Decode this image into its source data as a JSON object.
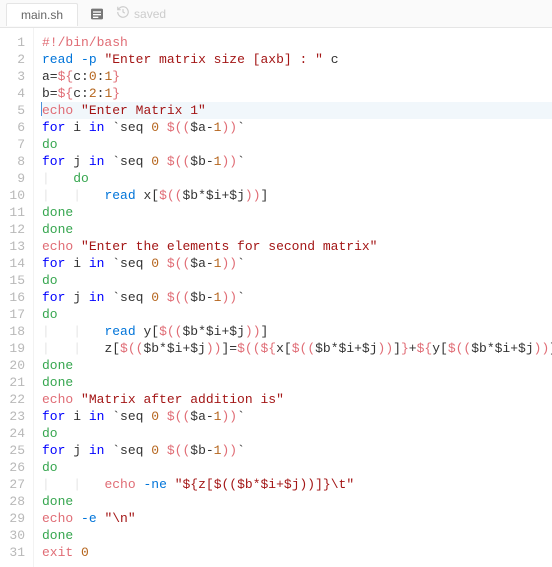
{
  "tab": {
    "filename": "main.sh"
  },
  "toolbar": {
    "saved_label": "saved"
  },
  "editor": {
    "active_line": 5,
    "lines": [
      {
        "n": 1,
        "tokens": [
          [
            "red",
            "#!/bin/bash"
          ]
        ]
      },
      {
        "n": 2,
        "tokens": [
          [
            "blue",
            "read"
          ],
          [
            "def",
            " "
          ],
          [
            "flag",
            "-p"
          ],
          [
            "def",
            " "
          ],
          [
            "str",
            "\"Enter matrix size [axb] : \""
          ],
          [
            "def",
            " c"
          ]
        ]
      },
      {
        "n": 3,
        "tokens": [
          [
            "def",
            "a="
          ],
          [
            "red",
            "${"
          ],
          [
            "def",
            "c:"
          ],
          [
            "num",
            "0"
          ],
          [
            "def",
            ":"
          ],
          [
            "num",
            "1"
          ],
          [
            "red",
            "}"
          ]
        ]
      },
      {
        "n": 4,
        "tokens": [
          [
            "def",
            "b="
          ],
          [
            "red",
            "${"
          ],
          [
            "def",
            "c:"
          ],
          [
            "num",
            "2"
          ],
          [
            "def",
            ":"
          ],
          [
            "num",
            "1"
          ],
          [
            "red",
            "}"
          ]
        ]
      },
      {
        "n": 5,
        "tokens": [
          [
            "red",
            "echo"
          ],
          [
            "def",
            " "
          ],
          [
            "str",
            "\"Enter Matrix 1\""
          ]
        ]
      },
      {
        "n": 6,
        "tokens": [
          [
            "kw",
            "for"
          ],
          [
            "def",
            " i "
          ],
          [
            "kw",
            "in"
          ],
          [
            "def",
            " `seq "
          ],
          [
            "num",
            "0"
          ],
          [
            "def",
            " "
          ],
          [
            "red",
            "$(("
          ],
          [
            "def",
            "$a-"
          ],
          [
            "num",
            "1"
          ],
          [
            "red",
            "))"
          ],
          [
            "def",
            "`"
          ]
        ]
      },
      {
        "n": 7,
        "tokens": [
          [
            "green",
            "do"
          ]
        ]
      },
      {
        "n": 8,
        "tokens": [
          [
            "kw",
            "for"
          ],
          [
            "def",
            " j "
          ],
          [
            "kw",
            "in"
          ],
          [
            "def",
            " `seq "
          ],
          [
            "num",
            "0"
          ],
          [
            "def",
            " "
          ],
          [
            "red",
            "$(("
          ],
          [
            "def",
            "$b-"
          ],
          [
            "num",
            "1"
          ],
          [
            "red",
            "))"
          ],
          [
            "def",
            "`"
          ]
        ]
      },
      {
        "n": 9,
        "indent": 1,
        "tokens": [
          [
            "green",
            "do"
          ]
        ]
      },
      {
        "n": 10,
        "indent": 2,
        "tokens": [
          [
            "blue",
            "read"
          ],
          [
            "def",
            " x["
          ],
          [
            "red",
            "$(("
          ],
          [
            "def",
            "$b*$i+$j"
          ],
          [
            "red",
            "))"
          ],
          [
            "def",
            "]"
          ]
        ]
      },
      {
        "n": 11,
        "tokens": [
          [
            "green",
            "done"
          ]
        ]
      },
      {
        "n": 12,
        "tokens": [
          [
            "green",
            "done"
          ]
        ]
      },
      {
        "n": 13,
        "tokens": [
          [
            "red",
            "echo"
          ],
          [
            "def",
            " "
          ],
          [
            "str",
            "\"Enter the elements for second matrix\""
          ]
        ]
      },
      {
        "n": 14,
        "tokens": [
          [
            "kw",
            "for"
          ],
          [
            "def",
            " i "
          ],
          [
            "kw",
            "in"
          ],
          [
            "def",
            " `seq "
          ],
          [
            "num",
            "0"
          ],
          [
            "def",
            " "
          ],
          [
            "red",
            "$(("
          ],
          [
            "def",
            "$a-"
          ],
          [
            "num",
            "1"
          ],
          [
            "red",
            "))"
          ],
          [
            "def",
            "`"
          ]
        ]
      },
      {
        "n": 15,
        "tokens": [
          [
            "green",
            "do"
          ]
        ]
      },
      {
        "n": 16,
        "tokens": [
          [
            "kw",
            "for"
          ],
          [
            "def",
            " j "
          ],
          [
            "kw",
            "in"
          ],
          [
            "def",
            " `seq "
          ],
          [
            "num",
            "0"
          ],
          [
            "def",
            " "
          ],
          [
            "red",
            "$(("
          ],
          [
            "def",
            "$b-"
          ],
          [
            "num",
            "1"
          ],
          [
            "red",
            "))"
          ],
          [
            "def",
            "`"
          ]
        ]
      },
      {
        "n": 17,
        "tokens": [
          [
            "green",
            "do"
          ]
        ]
      },
      {
        "n": 18,
        "indent": 2,
        "tokens": [
          [
            "blue",
            "read"
          ],
          [
            "def",
            " y["
          ],
          [
            "red",
            "$(("
          ],
          [
            "def",
            "$b*$i+$j"
          ],
          [
            "red",
            "))"
          ],
          [
            "def",
            "]"
          ]
        ]
      },
      {
        "n": 19,
        "indent": 2,
        "tokens": [
          [
            "def",
            "z["
          ],
          [
            "red",
            "$(("
          ],
          [
            "def",
            "$b*$i+$j"
          ],
          [
            "red",
            "))"
          ],
          [
            "def",
            "]="
          ],
          [
            "red",
            "$(("
          ],
          [
            "red",
            "${"
          ],
          [
            "def",
            "x["
          ],
          [
            "red",
            "$(("
          ],
          [
            "def",
            "$b*$i+$j"
          ],
          [
            "red",
            "))"
          ],
          [
            "def",
            "]"
          ],
          [
            "red",
            "}"
          ],
          [
            "def",
            "+"
          ],
          [
            "red",
            "${"
          ],
          [
            "def",
            "y["
          ],
          [
            "red",
            "$(("
          ],
          [
            "def",
            "$b*$i+$j"
          ],
          [
            "red",
            "))"
          ],
          [
            "def",
            "]"
          ],
          [
            "red",
            "}"
          ],
          [
            "red",
            "))"
          ]
        ]
      },
      {
        "n": 20,
        "tokens": [
          [
            "green",
            "done"
          ]
        ]
      },
      {
        "n": 21,
        "tokens": [
          [
            "green",
            "done"
          ]
        ]
      },
      {
        "n": 22,
        "tokens": [
          [
            "red",
            "echo"
          ],
          [
            "def",
            " "
          ],
          [
            "str",
            "\"Matrix after addition is\""
          ]
        ]
      },
      {
        "n": 23,
        "tokens": [
          [
            "kw",
            "for"
          ],
          [
            "def",
            " i "
          ],
          [
            "kw",
            "in"
          ],
          [
            "def",
            " `seq "
          ],
          [
            "num",
            "0"
          ],
          [
            "def",
            " "
          ],
          [
            "red",
            "$(("
          ],
          [
            "def",
            "$a-"
          ],
          [
            "num",
            "1"
          ],
          [
            "red",
            "))"
          ],
          [
            "def",
            "`"
          ]
        ]
      },
      {
        "n": 24,
        "tokens": [
          [
            "green",
            "do"
          ]
        ]
      },
      {
        "n": 25,
        "tokens": [
          [
            "kw",
            "for"
          ],
          [
            "def",
            " j "
          ],
          [
            "kw",
            "in"
          ],
          [
            "def",
            " `seq "
          ],
          [
            "num",
            "0"
          ],
          [
            "def",
            " "
          ],
          [
            "red",
            "$(("
          ],
          [
            "def",
            "$b-"
          ],
          [
            "num",
            "1"
          ],
          [
            "red",
            "))"
          ],
          [
            "def",
            "`"
          ]
        ]
      },
      {
        "n": 26,
        "tokens": [
          [
            "green",
            "do"
          ]
        ]
      },
      {
        "n": 27,
        "indent": 2,
        "tokens": [
          [
            "red",
            "echo"
          ],
          [
            "def",
            " "
          ],
          [
            "flag",
            "-ne"
          ],
          [
            "def",
            " "
          ],
          [
            "str",
            "\"${z[$(($b*$i+$j))]}\\t\""
          ]
        ]
      },
      {
        "n": 28,
        "tokens": [
          [
            "green",
            "done"
          ]
        ]
      },
      {
        "n": 29,
        "tokens": [
          [
            "red",
            "echo"
          ],
          [
            "def",
            " "
          ],
          [
            "flag",
            "-e"
          ],
          [
            "def",
            " "
          ],
          [
            "str",
            "\"\\n\""
          ]
        ]
      },
      {
        "n": 30,
        "tokens": [
          [
            "green",
            "done"
          ]
        ]
      },
      {
        "n": 31,
        "tokens": [
          [
            "red",
            "exit"
          ],
          [
            "def",
            " "
          ],
          [
            "num",
            "0"
          ]
        ]
      }
    ]
  }
}
